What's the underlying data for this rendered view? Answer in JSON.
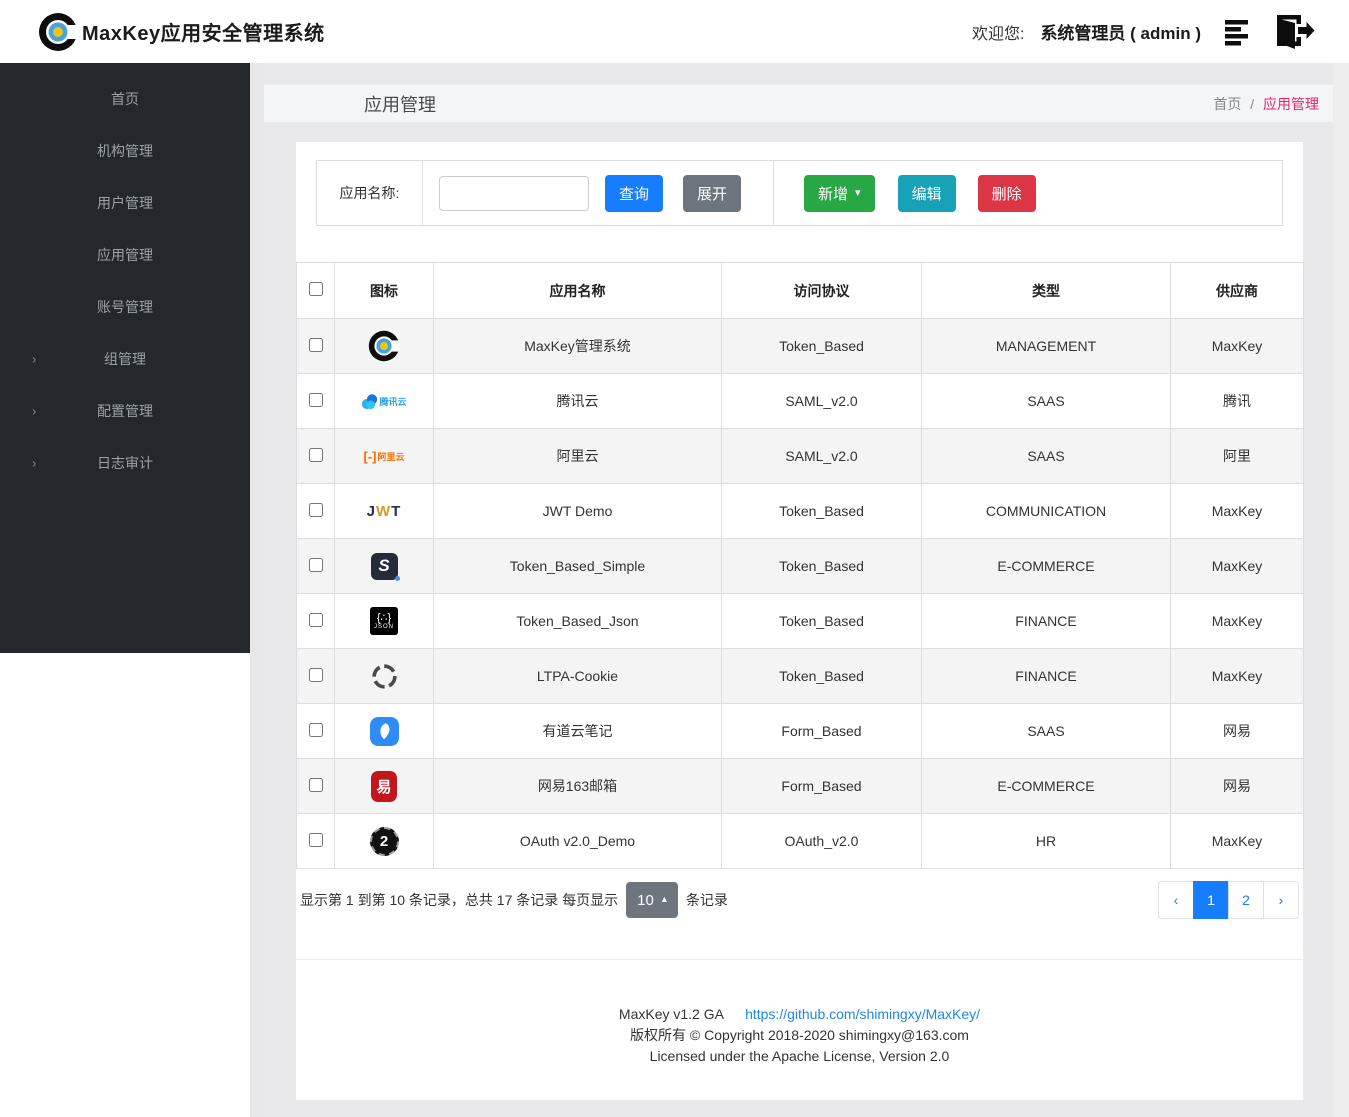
{
  "header": {
    "app_title": "MaxKey应用安全管理系统",
    "welcome_label": "欢迎您:",
    "user_label": "系统管理员 ( admin )"
  },
  "sidebar": {
    "items": [
      {
        "label": "首页",
        "expandable": false
      },
      {
        "label": "机构管理",
        "expandable": false
      },
      {
        "label": "用户管理",
        "expandable": false
      },
      {
        "label": "应用管理",
        "expandable": false
      },
      {
        "label": "账号管理",
        "expandable": false
      },
      {
        "label": "组管理",
        "expandable": true
      },
      {
        "label": "配置管理",
        "expandable": true
      },
      {
        "label": "日志审计",
        "expandable": true
      }
    ]
  },
  "breadcrumb": {
    "page_title": "应用管理",
    "home": "首页",
    "separator": "/",
    "current": "应用管理"
  },
  "toolbar": {
    "search_label": "应用名称:",
    "search_value": "",
    "query_label": "查询",
    "expand_label": "展开",
    "add_label": "新增",
    "edit_label": "编辑",
    "delete_label": "删除"
  },
  "table": {
    "headers": [
      "图标",
      "应用名称",
      "访问协议",
      "类型",
      "供应商"
    ],
    "rows": [
      {
        "icon": "maxkey-logo-icon",
        "name": "MaxKey管理系统",
        "protocol": "Token_Based",
        "type": "MANAGEMENT",
        "vendor": "MaxKey"
      },
      {
        "icon": "tencent-cloud-icon",
        "name": "腾讯云",
        "protocol": "SAML_v2.0",
        "type": "SAAS",
        "vendor": "腾讯"
      },
      {
        "icon": "aliyun-icon",
        "name": "阿里云",
        "protocol": "SAML_v2.0",
        "type": "SAAS",
        "vendor": "阿里"
      },
      {
        "icon": "jwt-icon",
        "name": "JWT Demo",
        "protocol": "Token_Based",
        "type": "COMMUNICATION",
        "vendor": "MaxKey"
      },
      {
        "icon": "simple-app-icon",
        "name": "Token_Based_Simple",
        "protocol": "Token_Based",
        "type": "E-COMMERCE",
        "vendor": "MaxKey"
      },
      {
        "icon": "json-app-icon",
        "name": "Token_Based_Json",
        "protocol": "Token_Based",
        "type": "FINANCE",
        "vendor": "MaxKey"
      },
      {
        "icon": "ltpa-cookie-icon",
        "name": "LTPA-Cookie",
        "protocol": "Token_Based",
        "type": "FINANCE",
        "vendor": "MaxKey"
      },
      {
        "icon": "youdao-note-icon",
        "name": "有道云笔记",
        "protocol": "Form_Based",
        "type": "SAAS",
        "vendor": "网易"
      },
      {
        "icon": "netease-163-icon",
        "name": "网易163邮箱",
        "protocol": "Form_Based",
        "type": "E-COMMERCE",
        "vendor": "网易"
      },
      {
        "icon": "oauth2-icon",
        "name": "OAuth v2.0_Demo",
        "protocol": "OAuth_v2.0",
        "type": "HR",
        "vendor": "MaxKey"
      }
    ],
    "jwt_letters": {
      "j": "J",
      "w": "W",
      "t": "T"
    },
    "tencent_label": "腾讯云",
    "aliyun_bracket": "[-]",
    "aliyun_label": "阿里云",
    "simple_letter": "S",
    "json_braces": "{∴}",
    "json_label": "JSON",
    "netease_glyph": "易",
    "oauth2_glyph": "2"
  },
  "pagination": {
    "info_prefix": "显示第 1 到第 10 条记录，总共 17 条记录  每页显示",
    "page_size": "10",
    "info_suffix": "条记录",
    "prev": "‹",
    "page1": "1",
    "page2": "2",
    "next": "›"
  },
  "footer": {
    "version": "MaxKey  v1.2 GA",
    "link": "https://github.com/shimingxy/MaxKey/",
    "copyright": "版权所有 © Copyright 2018-2020 shimingxy@163.com",
    "license": "Licensed under the Apache License, Version 2.0"
  },
  "glyphs": {
    "caret_down": "▾",
    "caret_up": "▴",
    "chevron_right": "›"
  },
  "colors": {
    "primary_blue": "#177dff",
    "success_green": "#28a745",
    "info_teal": "#17a2b8",
    "danger_red": "#dc3545",
    "secondary_gray": "#6c757d",
    "breadcrumb_pink": "#e6256f",
    "link_blue": "#1e88e5",
    "sidebar_bg": "#24272b",
    "stripe_gray": "#f4f4f4"
  }
}
